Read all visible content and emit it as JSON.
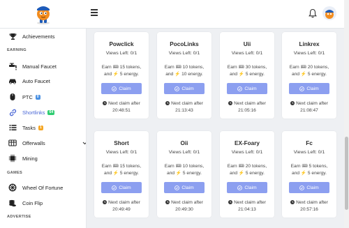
{
  "sidebar": {
    "items": [
      {
        "label": "Achievements",
        "icon": "trophy-icon"
      },
      {
        "label": "Manual Faucet",
        "icon": "faucet-icon"
      },
      {
        "label": "Auto Faucet",
        "icon": "car-icon"
      },
      {
        "label": "PTC",
        "icon": "mouse-icon",
        "badge": "0"
      },
      {
        "label": "Shortlinks",
        "icon": "link-icon",
        "badge": "64"
      },
      {
        "label": "Tasks",
        "icon": "list-icon",
        "badge": "1"
      },
      {
        "label": "Offerwalls",
        "icon": "offerwall-icon"
      },
      {
        "label": "Mining",
        "icon": "chip-icon"
      },
      {
        "label": "Wheel Of Fortune",
        "icon": "wheel-icon"
      },
      {
        "label": "Coin Flip",
        "icon": "coins-icon"
      }
    ],
    "sections": {
      "earning": "EARNING",
      "games": "GAMES",
      "advertise": "ADVERTISE"
    }
  },
  "colors": {
    "accent": "#4a67d6",
    "claim_button": "#8c9ff0",
    "badge_blue": "#4a90e2",
    "badge_green": "#2ecc71",
    "badge_orange": "#f5a623"
  },
  "cards": [
    {
      "name": "Powclick",
      "views": "Views Left: 0/1",
      "earn_line1": "Earn 🎟 15 tokens,",
      "earn_line2": "and ⚡ 5 energy.",
      "claim": "Claim",
      "next_line1": "Next claim after",
      "next_line2": "20:48:51"
    },
    {
      "name": "PocoLinks",
      "views": "Views Left: 0/1",
      "earn_line1": "Earn 🎟 10 tokens,",
      "earn_line2": "and ⚡ 10 energy.",
      "claim": "Claim",
      "next_line1": "Next claim after",
      "next_line2": "21:13:43"
    },
    {
      "name": "Uii",
      "views": "Views Left: 0/1",
      "earn_line1": "Earn 🎟 30 tokens,",
      "earn_line2": "and ⚡ 5 energy.",
      "claim": "Claim",
      "next_line1": "Next claim after",
      "next_line2": "21:05:16"
    },
    {
      "name": "Linkrex",
      "views": "Views Left: 0/1",
      "earn_line1": "Earn 🎟 20 tokens,",
      "earn_line2": "and ⚡ 5 energy.",
      "claim": "Claim",
      "next_line1": "Next claim after",
      "next_line2": "21:08:47"
    },
    {
      "name": "Short",
      "views": "Views Left: 0/1",
      "earn_line1": "Earn 🎟 15 tokens,",
      "earn_line2": "and ⚡ 5 energy.",
      "claim": "Claim",
      "next_line1": "Next claim after",
      "next_line2": "20:49:49"
    },
    {
      "name": "Oii",
      "views": "Views Left: 0/1",
      "earn_line1": "Earn 🎟 10 tokens,",
      "earn_line2": "and ⚡ 5 energy.",
      "claim": "Claim",
      "next_line1": "Next claim after",
      "next_line2": "20:49:30"
    },
    {
      "name": "EX-Foary",
      "views": "Views Left: 0/1",
      "earn_line1": "Earn 🎟 20 tokens,",
      "earn_line2": "and ⚡ 5 energy.",
      "claim": "Claim",
      "next_line1": "Next claim after",
      "next_line2": "21:04:13"
    },
    {
      "name": "Fc",
      "views": "Views Left: 0/1",
      "earn_line1": "Earn 🎟 5 tokens,",
      "earn_line2": "and ⚡ 5 energy.",
      "claim": "Claim",
      "next_line1": "Next claim after",
      "next_line2": "20:57:16"
    }
  ]
}
